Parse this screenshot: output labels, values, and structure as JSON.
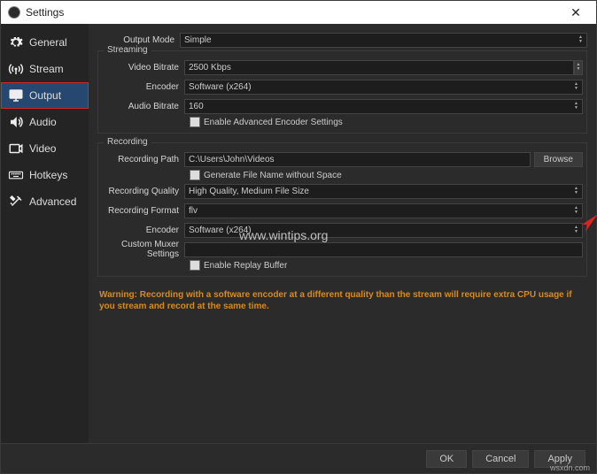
{
  "window": {
    "title": "Settings"
  },
  "sidebar": {
    "items": [
      {
        "label": "General"
      },
      {
        "label": "Stream"
      },
      {
        "label": "Output"
      },
      {
        "label": "Audio"
      },
      {
        "label": "Video"
      },
      {
        "label": "Hotkeys"
      },
      {
        "label": "Advanced"
      }
    ]
  },
  "output_mode": {
    "label": "Output Mode",
    "value": "Simple"
  },
  "streaming": {
    "title": "Streaming",
    "video_bitrate": {
      "label": "Video Bitrate",
      "value": "2500 Kbps"
    },
    "encoder": {
      "label": "Encoder",
      "value": "Software (x264)"
    },
    "audio_bitrate": {
      "label": "Audio Bitrate",
      "value": "160"
    },
    "enable_advanced": {
      "label": "Enable Advanced Encoder Settings"
    }
  },
  "recording": {
    "title": "Recording",
    "path": {
      "label": "Recording Path",
      "value": "C:\\Users\\John\\Videos",
      "browse": "Browse"
    },
    "gen_filename": {
      "label": "Generate File Name without Space"
    },
    "quality": {
      "label": "Recording Quality",
      "value": "High Quality, Medium File Size"
    },
    "format": {
      "label": "Recording Format",
      "value": "flv"
    },
    "encoder": {
      "label": "Encoder",
      "value": "Software (x264)"
    },
    "muxer": {
      "label": "Custom Muxer Settings",
      "value": ""
    },
    "replay_buffer": {
      "label": "Enable Replay Buffer"
    }
  },
  "warning": "Warning: Recording with a software encoder at a different quality than the stream will require extra CPU usage if you stream and record at the same time.",
  "footer": {
    "ok": "OK",
    "cancel": "Cancel",
    "apply": "Apply"
  },
  "watermark": "www.wintips.org",
  "watermark2": "wsxdn.com"
}
